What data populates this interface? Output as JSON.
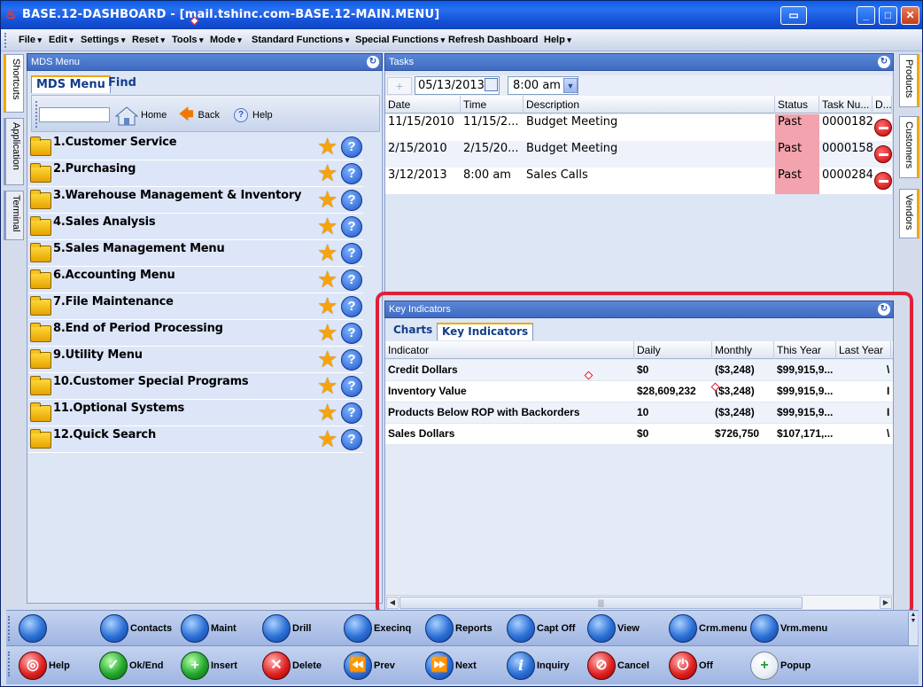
{
  "window": {
    "title": "BASE.12-DASHBOARD - [mail.tshinc.com-BASE.12-MAIN.MENU]",
    "min_label": "_",
    "max_label": "□",
    "close_label": "✕"
  },
  "menubar": {
    "items": [
      "File",
      "Edit",
      "Settings",
      "Reset",
      "Tools",
      "Mode",
      "Standard Functions",
      "Special Functions",
      "Refresh Dashboard",
      "Help"
    ]
  },
  "left_tabs": [
    "Shortcuts",
    "Application",
    "Terminal"
  ],
  "right_tabs": [
    "Products",
    "Customers",
    "Vendors"
  ],
  "mds": {
    "header": "MDS Menu",
    "tabs": [
      "MDS Menu",
      "Find"
    ],
    "search_value": "",
    "home_label": "Home",
    "back_label": "Back",
    "help_label": "Help",
    "items": [
      "1.Customer Service",
      "2.Purchasing",
      "3.Warehouse Management & Inventory",
      "4.Sales Analysis",
      "5.Sales Management Menu",
      "6.Accounting Menu",
      "7.File Maintenance",
      "8.End of Period Processing",
      "9.Utility Menu",
      "10.Customer Special Programs",
      "11.Optional Systems",
      "12.Quick Search"
    ]
  },
  "tasks": {
    "header": "Tasks",
    "date_value": "05/13/2013",
    "time_value": "8:00 am",
    "columns": [
      "Date",
      "Time",
      "Description",
      "Status",
      "Task Nu...",
      "D..."
    ],
    "rows": [
      {
        "date": "11/15/2010",
        "time": "11/15/2...",
        "description": "Budget Meeting",
        "status": "Past",
        "task_no": "0000182"
      },
      {
        "date": "2/15/2010",
        "time": "2/15/20...",
        "description": "Budget Meeting",
        "status": "Past",
        "task_no": "0000158"
      },
      {
        "date": "3/12/2013",
        "time": "8:00 am",
        "description": "Sales Calls",
        "status": "Past",
        "task_no": "0000284"
      }
    ],
    "status_color": "#f2a3ad"
  },
  "key_indicators": {
    "header": "Key Indicators",
    "tabs": [
      "Charts",
      "Key Indicators"
    ],
    "columns": [
      "Indicator",
      "Daily",
      "Monthly",
      "This Year",
      "Last Year"
    ],
    "rows": [
      {
        "indicator": "Credit Dollars",
        "daily": "$0",
        "monthly": "($3,248)",
        "this_year": "$99,915,9...",
        "last_year": "",
        "extra": "\\"
      },
      {
        "indicator": "Inventory Value",
        "daily": "$28,609,232",
        "monthly": "($3,248)",
        "this_year": "$99,915,9...",
        "last_year": "",
        "extra": "I"
      },
      {
        "indicator": "Products Below ROP with Backorders",
        "daily": "10",
        "monthly": "($3,248)",
        "this_year": "$99,915,9...",
        "last_year": "",
        "extra": "I"
      },
      {
        "indicator": "Sales Dollars",
        "daily": "$0",
        "monthly": "$726,750",
        "this_year": "$107,171,...",
        "last_year": "",
        "extra": "\\"
      }
    ],
    "highlight_color": "#e0203a"
  },
  "toolbar_top": [
    {
      "label": "",
      "icon": "globe-icon"
    },
    {
      "label": "Contacts",
      "icon": "globe-icon"
    },
    {
      "label": "Maint",
      "icon": "globe-icon"
    },
    {
      "label": "Drill",
      "icon": "globe-icon"
    },
    {
      "label": "Execinq",
      "icon": "globe-icon"
    },
    {
      "label": "Reports",
      "icon": "globe-icon"
    },
    {
      "label": "Capt Off",
      "icon": "globe-icon"
    },
    {
      "label": "View",
      "icon": "globe-icon"
    },
    {
      "label": "Crm.menu",
      "icon": "globe-icon"
    },
    {
      "label": "Vrm.menu",
      "icon": "globe-icon"
    }
  ],
  "toolbar_bottom": [
    {
      "label": "Help",
      "icon": "lifebuoy-icon"
    },
    {
      "label": "Ok/End",
      "icon": "check-icon"
    },
    {
      "label": "Insert",
      "icon": "plus-icon"
    },
    {
      "label": "Delete",
      "icon": "x-icon"
    },
    {
      "label": "Prev",
      "icon": "rewind-icon"
    },
    {
      "label": "Next",
      "icon": "forward-icon"
    },
    {
      "label": "Inquiry",
      "icon": "info-icon"
    },
    {
      "label": "Cancel",
      "icon": "no-entry-icon"
    },
    {
      "label": "Off",
      "icon": "power-icon"
    },
    {
      "label": "Popup",
      "icon": "database-add-icon"
    }
  ]
}
